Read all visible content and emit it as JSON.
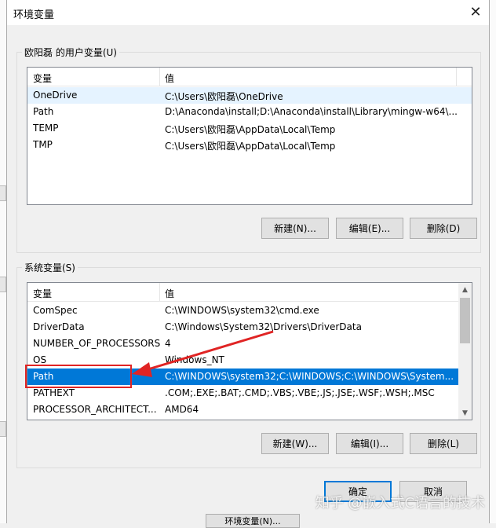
{
  "window": {
    "title": "环境变量",
    "close_glyph": "✕"
  },
  "user_vars": {
    "group_label": "欧阳磊 的用户变量(U)",
    "columns": [
      "变量",
      "值"
    ],
    "rows": [
      {
        "name": "OneDrive",
        "value": "C:\\Users\\欧阳磊\\OneDrive"
      },
      {
        "name": "Path",
        "value": "D:\\Anaconda\\install;D:\\Anaconda\\install\\Library\\mingw-w64\\..."
      },
      {
        "name": "TEMP",
        "value": "C:\\Users\\欧阳磊\\AppData\\Local\\Temp"
      },
      {
        "name": "TMP",
        "value": "C:\\Users\\欧阳磊\\AppData\\Local\\Temp"
      }
    ],
    "buttons": {
      "new": "新建(N)...",
      "edit": "编辑(E)...",
      "delete": "删除(D)"
    }
  },
  "system_vars": {
    "group_label": "系统变量(S)",
    "columns": [
      "变量",
      "值"
    ],
    "rows": [
      {
        "name": "ComSpec",
        "value": "C:\\WINDOWS\\system32\\cmd.exe"
      },
      {
        "name": "DriverData",
        "value": "C:\\Windows\\System32\\Drivers\\DriverData"
      },
      {
        "name": "NUMBER_OF_PROCESSORS",
        "value": "4"
      },
      {
        "name": "OS",
        "value": "Windows_NT"
      },
      {
        "name": "Path",
        "value": "C:\\WINDOWS\\system32;C:\\WINDOWS;C:\\WINDOWS\\System..."
      },
      {
        "name": "PATHEXT",
        "value": ".COM;.EXE;.BAT;.CMD;.VBS;.VBE;.JS;.JSE;.WSF;.WSH;.MSC"
      },
      {
        "name": "PROCESSOR_ARCHITECT...",
        "value": "AMD64"
      }
    ],
    "selected_row": "Path",
    "buttons": {
      "new": "新建(W)...",
      "edit": "编辑(I)...",
      "delete": "删除(L)"
    }
  },
  "footer": {
    "ok": "确定",
    "cancel": "取消"
  },
  "background": {
    "bottom_button": "环境变量(N)..."
  },
  "watermark": "知乎 @嵌入式C语言的技术",
  "colors": {
    "selection": "#0078d7",
    "annotation": "#e02424",
    "hover": "#e5f3ff"
  }
}
